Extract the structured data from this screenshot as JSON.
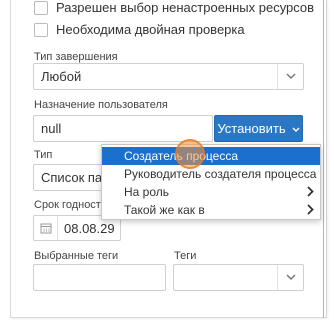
{
  "checkboxes": [
    {
      "label": "Разрешен выбор ненастроенных ресурсов",
      "checked": false
    },
    {
      "label": "Необходима двойная проверка",
      "checked": false
    }
  ],
  "completion_type": {
    "label": "Тип завершения",
    "value": "Любой"
  },
  "user_assignment": {
    "label": "Назначение пользователя",
    "value": "null",
    "button_label": "Установить"
  },
  "type_field": {
    "label": "Тип",
    "value": "Список пара"
  },
  "expiry": {
    "label": "Срок годности",
    "value": "08.08.29"
  },
  "selected_tags": {
    "label": "Выбранные теги",
    "value": ""
  },
  "tags": {
    "label": "Теги",
    "value": ""
  },
  "dropdown_menu": {
    "items": [
      {
        "label": "Создатель процесса",
        "active": true,
        "has_submenu": false
      },
      {
        "label": "Руководитель создателя процесса",
        "active": false,
        "has_submenu": false
      },
      {
        "label": "На роль",
        "active": false,
        "has_submenu": true
      },
      {
        "label": "Такой же как в",
        "active": false,
        "has_submenu": true
      }
    ]
  },
  "colors": {
    "accent": "#2a78c5",
    "menu_highlight": "#1b6fcd",
    "cursor_highlight": "#f5963c"
  }
}
